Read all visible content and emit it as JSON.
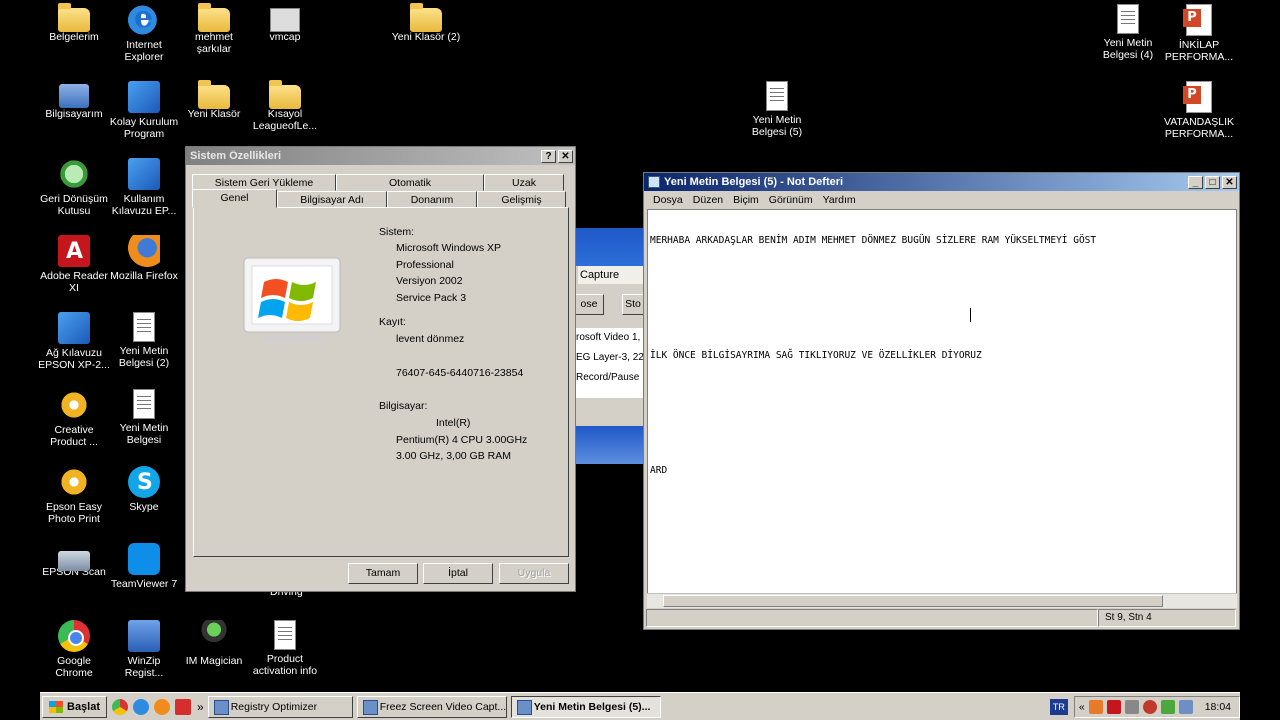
{
  "desktop": {
    "icons": [
      {
        "label": "Belgelerim",
        "icon": "folder-icon"
      },
      {
        "label": "Internet\nExplorer",
        "icon": "ie-icon"
      },
      {
        "label": "mehmet\nşarkılar",
        "icon": "folder-icon"
      },
      {
        "label": "vmcap",
        "icon": "camera-icon"
      },
      {
        "label": "Yeni Klasör (2)",
        "icon": "folder-icon"
      },
      {
        "label": "Yeni Metin\nBelgesi (4)",
        "icon": "document-icon"
      },
      {
        "label": "İNKİLAP\nPERFORMA...",
        "icon": "powerpoint-icon"
      },
      {
        "label": "Bilgisayarım",
        "icon": "computer-icon"
      },
      {
        "label": "Kolay Kurulum\nProgram",
        "icon": "wizard-icon"
      },
      {
        "label": "Yeni Klasör",
        "icon": "folder-icon"
      },
      {
        "label": "Kısayol\nLeagueofLe...",
        "icon": "folder-icon"
      },
      {
        "label": "Yeni Metin\nBelgesi (5)",
        "icon": "document-icon"
      },
      {
        "label": "VATANDAŞLIK\nPERFORMA...",
        "icon": "powerpoint-icon"
      },
      {
        "label": "Geri Dönüşüm\nKutusu",
        "icon": "recycle-bin-icon"
      },
      {
        "label": "Kullanım\nKılavuzu EP...",
        "icon": "wizard-icon"
      },
      {
        "label": "Adobe Reader\nXI",
        "icon": "adobe-reader-icon"
      },
      {
        "label": "Mozilla Firefox",
        "icon": "firefox-icon"
      },
      {
        "label": "Ağ Kılavuzu\nEPSON XP-2...",
        "icon": "wizard-icon"
      },
      {
        "label": "Yeni Metin\nBelgesi (2)",
        "icon": "document-icon"
      },
      {
        "label": "Creative\nProduct ...",
        "icon": "gear-icon"
      },
      {
        "label": "Yeni Metin\nBelgesi",
        "icon": "document-icon"
      },
      {
        "label": "Epson Easy\nPhoto Print",
        "icon": "gear-icon"
      },
      {
        "label": "Skype",
        "icon": "skype-icon"
      },
      {
        "label": "EPSON Scan",
        "icon": "scanner-icon"
      },
      {
        "label": "TeamViewer 7",
        "icon": "teamviewer-icon"
      },
      {
        "label": "Google\nChrome",
        "icon": "chrome-icon"
      },
      {
        "label": "WinZip\nRegist...",
        "icon": "winzip-icon"
      },
      {
        "label": "IM Magician",
        "icon": "magician-icon"
      },
      {
        "label": "Product\nactivation info",
        "icon": "document-icon"
      }
    ],
    "partial_label": "Driving"
  },
  "background_window": {
    "menu_tab": "Capture",
    "buttons": [
      "ose",
      "Sto"
    ],
    "lines": [
      "rosoft Video 1,",
      "EG Layer-3, 22",
      "Record/Pause I"
    ]
  },
  "sysprops": {
    "title": "Sistem Özellikleri",
    "help_btn": "?",
    "close_btn": "✕",
    "tabs_back": [
      "Sistem Geri Yükleme",
      "Otomatik Güncelleştirmeler",
      "Uzak"
    ],
    "tabs_front": [
      "Genel",
      "Bilgisayar Adı",
      "Donanım",
      "Gelişmiş"
    ],
    "sistem_label": "Sistem:",
    "sistem_lines": [
      "Microsoft Windows XP",
      "Professional",
      "Versiyon 2002",
      "Service Pack 3"
    ],
    "kayit_label": "Kayıt:",
    "kayit_name": "levent  dönmez",
    "product_id": "76407-645-6440716-23854",
    "computer_label": "Bilgisayar:",
    "computer_lines": [
      "Intel(R)",
      "Pentium(R) 4 CPU 3.00GHz",
      "3.00 GHz, 3,00 GB RAM"
    ],
    "ok": "Tamam",
    "cancel": "İptal",
    "apply": "Uygula"
  },
  "notepad": {
    "title": "Yeni Metin Belgesi (5) - Not Defteri",
    "menu": [
      "Dosya",
      "Düzen",
      "Biçim",
      "Görünüm",
      "Yardım"
    ],
    "lines": [
      "MERHABA ARKADAŞLAR BENİM ADIM MEHMET DÖNMEZ BUGÜN SİZLERE RAM YÜKSELTMEYİ GÖST",
      "",
      "",
      "İLK ÖNCE BİLGİSAYRIMA SAĞ TIKLIYORUZ VE ÖZELLİKLER DİYORUZ",
      "",
      "",
      "ARD"
    ],
    "status_pos": "St 9, Stn 4",
    "min": "_",
    "max": "□",
    "close": "✕"
  },
  "taskbar": {
    "start": "Başlat",
    "chevron": "»",
    "tasks": [
      {
        "label": "Registry Optimizer",
        "active": false
      },
      {
        "label": "Freez Screen Video Capt...",
        "active": false
      },
      {
        "label": "Yeni Metin Belgesi (5)...",
        "active": true
      }
    ],
    "lang": "TR",
    "tray_chevron": "«",
    "clock": "18:04"
  }
}
